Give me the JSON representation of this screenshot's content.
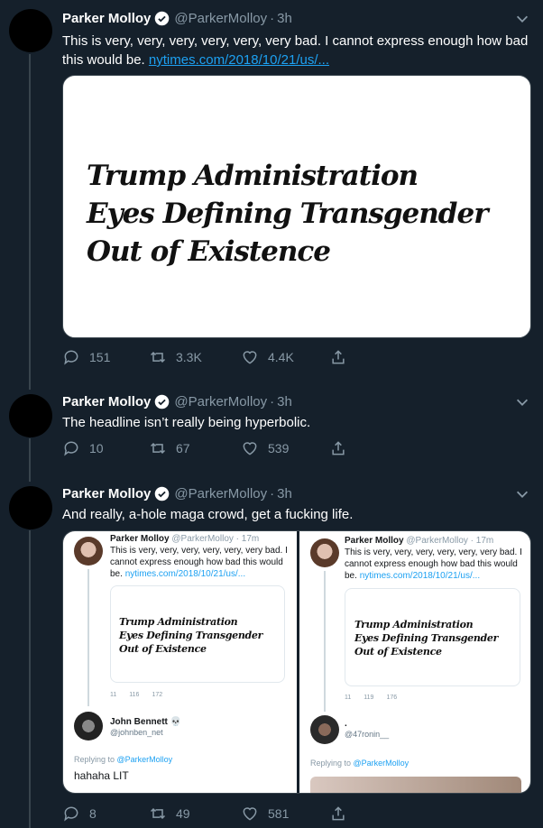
{
  "colors": {
    "background": "#15202b",
    "accent": "#1da1f2",
    "muted": "#8899a6",
    "line": "#38444d"
  },
  "tweets": [
    {
      "name": "Parker Molloy",
      "handle": "@ParkerMolloy",
      "dot": "·",
      "time": "3h",
      "text": "This is very, very, very, very, very, very bad. I cannot express enough how bad this would be. ",
      "link": "nytimes.com/2018/10/21/us/...",
      "card_headline": "Trump Administration\nEyes Defining Transgender\nOut of Existence",
      "replies": "151",
      "retweets": "3.3K",
      "likes": "4.4K"
    },
    {
      "name": "Parker Molloy",
      "handle": "@ParkerMolloy",
      "dot": "·",
      "time": "3h",
      "text": "The headline isn’t really being hyperbolic.",
      "replies": "10",
      "retweets": "67",
      "likes": "539"
    },
    {
      "name": "Parker Molloy",
      "handle": "@ParkerMolloy",
      "dot": "·",
      "time": "3h",
      "text": "And really, a-hole maga crowd, get a fucking life.",
      "replies": "8",
      "retweets": "49",
      "likes": "581"
    }
  ],
  "screenshots": [
    {
      "name": "Parker Molloy",
      "handle": "@ParkerMolloy · 17m",
      "text": "This is very, very, very, very, very, very bad. I cannot express enough how bad this would be. ",
      "link": "nytimes.com/2018/10/21/us/...",
      "headline": "Trump Administration\nEyes Defining Transgender\nOut of Existence",
      "replies": "11",
      "retweets": "116",
      "likes": "172",
      "reply_name": "John Bennett 💀",
      "reply_handle": "@johnben_net",
      "replying_to": "Replying to ",
      "replying_user": "@ParkerMolloy",
      "reply_text": "hahaha LIT"
    },
    {
      "name": "Parker Molloy",
      "handle": "@ParkerMolloy · 17m",
      "text": "This is very, very, very, very, very, very bad. I cannot express enough how bad this would be. ",
      "link": "nytimes.com/2018/10/21/us/...",
      "headline": "Trump Administration\nEyes Defining Transgender\nOut of Existence",
      "replies": "11",
      "retweets": "119",
      "likes": "176",
      "reply_name": ".",
      "reply_handle": "@47ronin__",
      "replying_to": "Replying to ",
      "replying_user": "@ParkerMolloy"
    }
  ]
}
